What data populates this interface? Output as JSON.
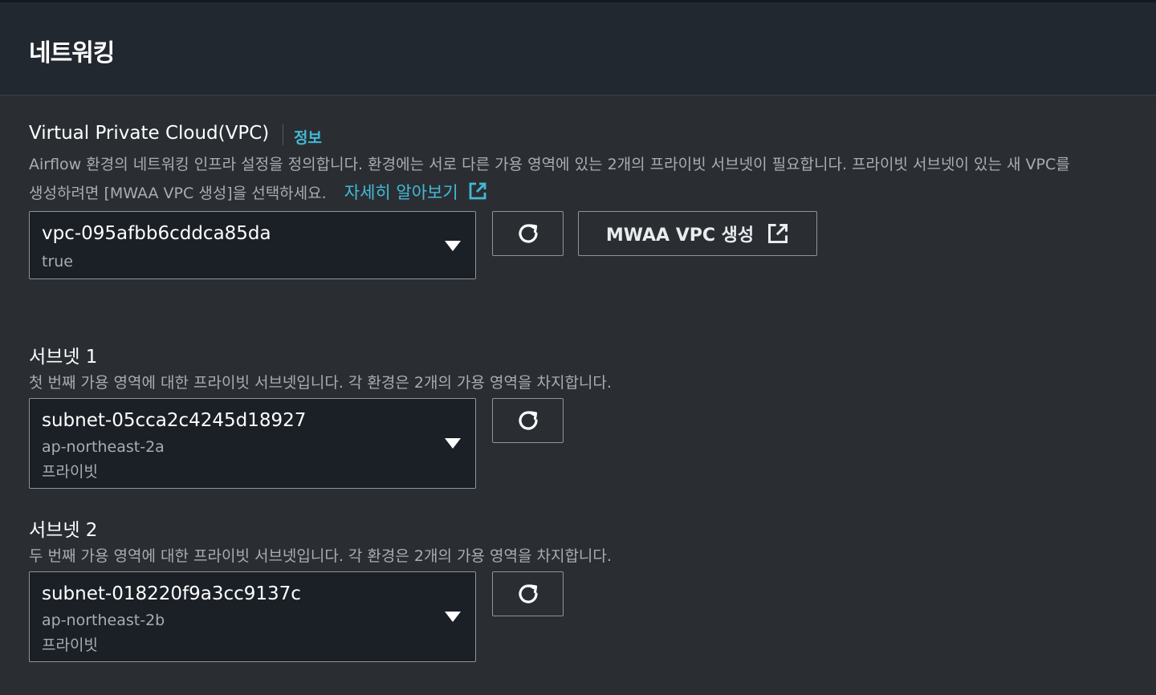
{
  "header": {
    "title": "네트워킹"
  },
  "vpc": {
    "label": "Virtual Private Cloud(VPC)",
    "info_link": "정보",
    "description_line1": "Airflow 환경의 네트워킹 인프라 설정을 정의합니다. 환경에는 서로 다른 가용 영역에 있는 2개의 프라이빗 서브넷이 필요합니다. 프라이빗 서브넷이 있는 새 VPC를",
    "description_line2": "생성하려면 [MWAA VPC 생성]을 선택하세요.",
    "learn_more": "자세히 알아보기",
    "selected_value": "vpc-095afbb6cddca85da",
    "selected_sub": "true",
    "create_button": "MWAA VPC 생성"
  },
  "subnet1": {
    "label": "서브넷 1",
    "description": "첫 번째 가용 영역에 대한 프라이빗 서브넷입니다. 각 환경은 2개의 가용 영역을 차지합니다.",
    "selected_value": "subnet-05cca2c4245d18927",
    "az": "ap-northeast-2a",
    "type": "프라이빗"
  },
  "subnet2": {
    "label": "서브넷 2",
    "description": "두 번째 가용 영역에 대한 프라이빗 서브넷입니다. 각 환경은 2개의 가용 영역을 차지합니다.",
    "selected_value": "subnet-018220f9a3cc9137c",
    "az": "ap-northeast-2b",
    "type": "프라이빗"
  },
  "icons": {
    "refresh": "refresh-icon",
    "external": "external-link-icon",
    "caret": "caret-down-icon"
  },
  "colors": {
    "link": "#44b9d6",
    "background": "#2a2e33",
    "header_background": "#222830",
    "input_background": "#1b1f26"
  }
}
